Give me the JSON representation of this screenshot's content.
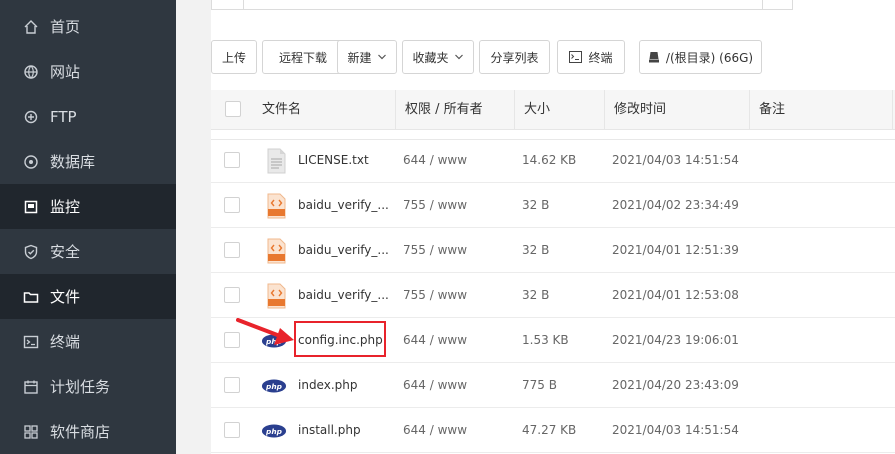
{
  "sidebar": {
    "items": [
      {
        "label": "首页",
        "icon": "home-icon"
      },
      {
        "label": "网站",
        "icon": "globe-icon"
      },
      {
        "label": "FTP",
        "icon": "ftp-icon"
      },
      {
        "label": "数据库",
        "icon": "database-icon"
      },
      {
        "label": "监控",
        "icon": "monitor-icon",
        "active": true
      },
      {
        "label": "安全",
        "icon": "shield-icon"
      },
      {
        "label": "文件",
        "icon": "folder-icon",
        "active": true
      },
      {
        "label": "终端",
        "icon": "terminal-icon"
      },
      {
        "label": "计划任务",
        "icon": "calendar-icon"
      },
      {
        "label": "软件商店",
        "icon": "store-icon"
      }
    ]
  },
  "toolbar": {
    "upload": "上传",
    "remote_download": "远程下载",
    "new": "新建",
    "favorites": "收藏夹",
    "share_list": "分享列表",
    "terminal": "终端",
    "disk": "/(根目录) (66G)"
  },
  "table": {
    "headers": {
      "name": "文件名",
      "perm": "权限 / 所有者",
      "size": "大小",
      "mtime": "修改时间",
      "note": "备注"
    },
    "rows": [
      {
        "name": "LICENSE.txt",
        "perm": "644 / www",
        "size": "14.62 KB",
        "mtime": "2021/04/03 14:51:54",
        "type": "txt"
      },
      {
        "name": "baidu_verify_...",
        "perm": "755 / www",
        "size": "32 B",
        "mtime": "2021/04/02 23:34:49",
        "type": "html"
      },
      {
        "name": "baidu_verify_...",
        "perm": "755 / www",
        "size": "32 B",
        "mtime": "2021/04/01 12:51:39",
        "type": "html"
      },
      {
        "name": "baidu_verify_...",
        "perm": "755 / www",
        "size": "32 B",
        "mtime": "2021/04/01 12:53:08",
        "type": "html"
      },
      {
        "name": "config.inc.php",
        "perm": "644 / www",
        "size": "1.53 KB",
        "mtime": "2021/04/23 19:06:01",
        "type": "php"
      },
      {
        "name": "index.php",
        "perm": "644 / www",
        "size": "775 B",
        "mtime": "2021/04/20 23:43:09",
        "type": "php"
      },
      {
        "name": "install.php",
        "perm": "644 / www",
        "size": "47.27 KB",
        "mtime": "2021/04/03 14:51:54",
        "type": "php"
      }
    ]
  },
  "colors": {
    "sidebar_bg": "#2f3740",
    "sidebar_active": "#20262d",
    "highlight": "#e8232b",
    "php_icon": "#2a3f8f",
    "html_icon": "#e8782f"
  }
}
